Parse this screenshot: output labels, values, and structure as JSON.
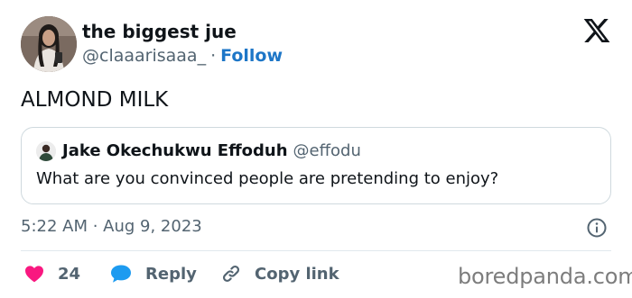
{
  "author": {
    "display_name": "the biggest jue",
    "handle": "@claaarisaaa_",
    "separator": "·",
    "follow_label": "Follow"
  },
  "tweet": {
    "text": "ALMOND MILK",
    "timestamp": "5:22 AM · Aug 9, 2023"
  },
  "quoted_tweet": {
    "author_name": "Jake Okechukwu Effoduh",
    "author_handle": "@effodu",
    "text": "What are you convinced people are pretending to enjoy?"
  },
  "actions": {
    "like_count": "24",
    "reply_label": "Reply",
    "copy_link_label": "Copy link"
  },
  "watermark": "boredpanda.com",
  "colors": {
    "text_primary": "#0f1419",
    "text_secondary": "#536471",
    "link_blue": "#1d76c7",
    "like_pink": "#f91880",
    "reply_blue": "#1d9bf0",
    "border": "#cfd9de"
  },
  "icons": {
    "brand": "x-logo-icon",
    "info": "info-icon",
    "like": "heart-icon",
    "reply": "speech-bubble-icon",
    "copy_link": "link-icon"
  }
}
